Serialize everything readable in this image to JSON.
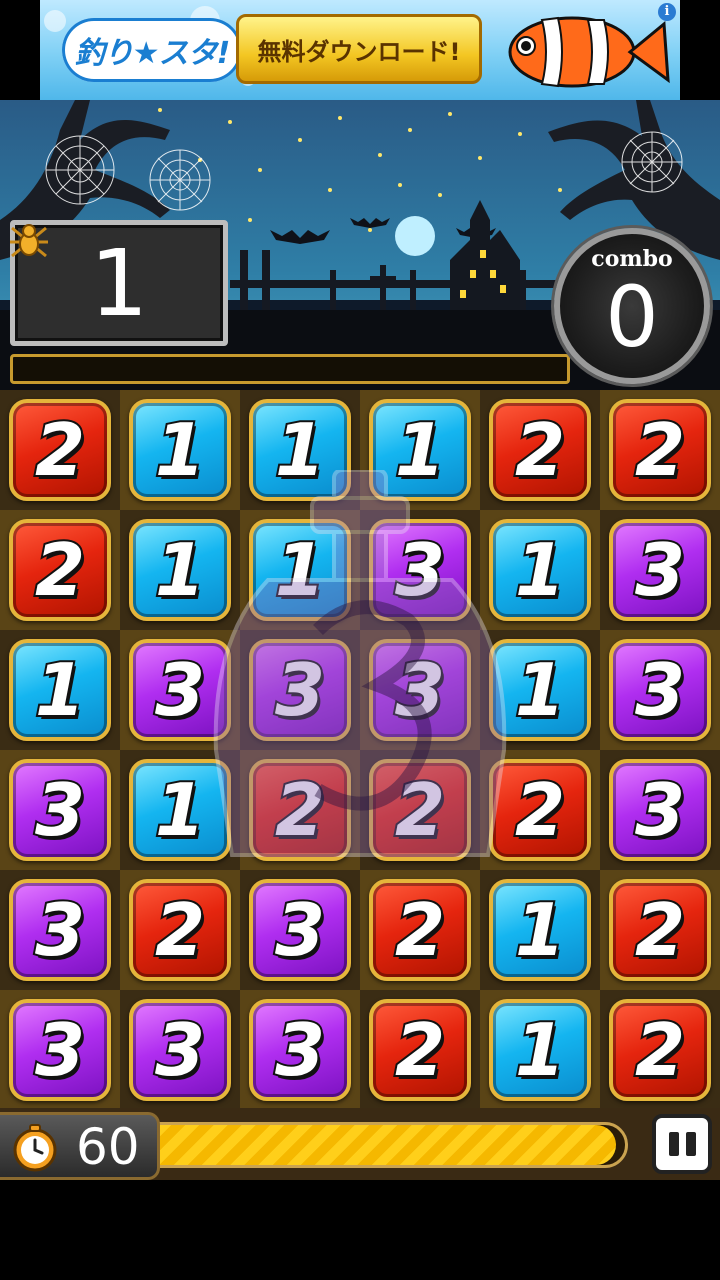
{
  "ad": {
    "logo_text": "釣り★スタ!",
    "button_label": "無料ダウンロード!",
    "info_icon": "i"
  },
  "hud": {
    "score": "1",
    "combo_label": "combo",
    "combo_value": "0",
    "timer_value": "60",
    "time_remaining_fraction": 0.98,
    "icons": [
      "spider-icon",
      "clock-icon",
      "pause-icon"
    ]
  },
  "board": {
    "rows": [
      [
        "2",
        "1",
        "1",
        "1",
        "2",
        "2"
      ],
      [
        "2",
        "1",
        "1",
        "3",
        "1",
        "3"
      ],
      [
        "1",
        "3",
        "3",
        "3",
        "1",
        "3"
      ],
      [
        "3",
        "1",
        "2",
        "2",
        "2",
        "3"
      ],
      [
        "3",
        "2",
        "3",
        "2",
        "1",
        "2"
      ],
      [
        "3",
        "3",
        "3",
        "2",
        "1",
        "2"
      ]
    ]
  },
  "colors": {
    "tile_1": "#14b5f0",
    "tile_2": "#e5250e",
    "tile_3": "#b02ef0",
    "gold_border": "#e5b53b"
  }
}
